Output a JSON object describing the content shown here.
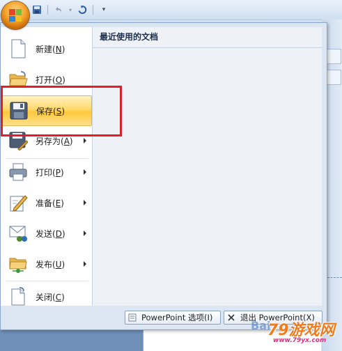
{
  "qat": {
    "buttons": [
      "save-icon",
      "undo-icon",
      "redo-icon",
      "customize-dropdown-icon"
    ]
  },
  "office_menu": {
    "items": [
      {
        "label": "新建",
        "key": "N",
        "icon": "new-document-icon",
        "submenu": false
      },
      {
        "label": "打开",
        "key": "O",
        "icon": "open-folder-icon",
        "submenu": false
      },
      {
        "label": "保存",
        "key": "S",
        "icon": "save-floppy-icon",
        "submenu": false,
        "selected": true
      },
      {
        "label": "另存为",
        "key": "A",
        "icon": "save-as-icon",
        "submenu": true
      },
      {
        "label": "打印",
        "key": "P",
        "icon": "printer-icon",
        "submenu": true
      },
      {
        "label": "准备",
        "key": "E",
        "icon": "prepare-pencil-icon",
        "submenu": true
      },
      {
        "label": "发送",
        "key": "D",
        "icon": "send-envelope-icon",
        "submenu": true
      },
      {
        "label": "发布",
        "key": "U",
        "icon": "publish-folder-icon",
        "submenu": true
      },
      {
        "label": "关闭",
        "key": "C",
        "icon": "close-document-icon",
        "submenu": false
      }
    ],
    "recent_documents": {
      "title": "最近使用的文档",
      "items": []
    },
    "footer": {
      "options_button": "PowerPoint 选项(I)",
      "exit_button": "退出 PowerPoint(X)"
    }
  },
  "watermark": {
    "baidu": "Bai",
    "site_logo": "游戏网",
    "site_prefix": "79",
    "url": "www.79yx.com"
  },
  "colors": {
    "highlight_border": "#e21f26",
    "selected_item_gradient": "#ffd86a",
    "menu_background": "#dce6f3"
  }
}
